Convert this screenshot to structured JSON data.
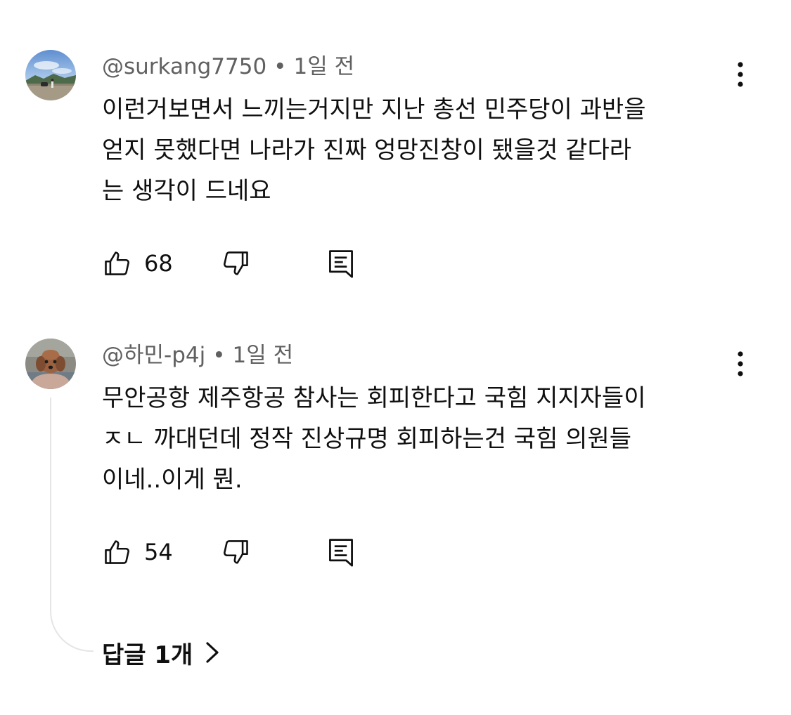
{
  "comments": [
    {
      "author": "@surkang7750",
      "time": "1일 전",
      "text": "이런거보면서 느끼는거지만 지난 총선 민주당이 과반을\n얻지 못했다면 나라가 진짜 엉망진창이 됐을것 같다라\n는 생각이 드네요",
      "likes": "68",
      "avatar_icon": "landscape-photo-avatar"
    },
    {
      "author": "@하민-p4j",
      "time": "1일 전",
      "text": "무안공항 제주항공 참사는 회피한다고 국힘 지지자들이\nㅈㄴ 까대던데 정작 진상규명 회피하는건 국힘 의원들\n이네..이게 뭔.",
      "likes": "54",
      "avatar_icon": "dog-photo-avatar"
    }
  ],
  "separator": "•",
  "replies": {
    "label": "답글 1개"
  },
  "icons": {
    "like": "thumbs-up-icon",
    "dislike": "thumbs-down-icon",
    "reply": "comment-icon",
    "more": "more-vertical-icon",
    "expand": "chevron-right-icon"
  },
  "colors": {
    "text_primary": "#0f0f0f",
    "text_secondary": "#606060",
    "thread_line": "#e5e5e5",
    "background": "#ffffff"
  }
}
